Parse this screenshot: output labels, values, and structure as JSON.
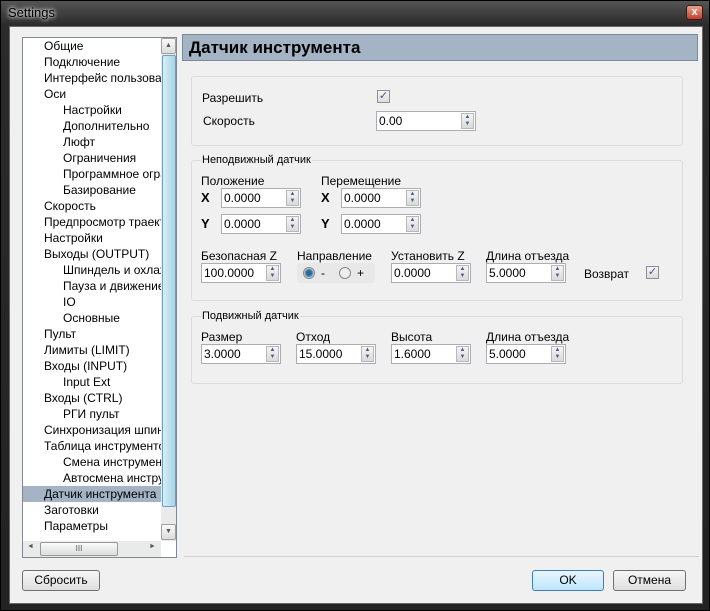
{
  "window": {
    "title": "Settings",
    "close_label": "x"
  },
  "tree": {
    "items": [
      {
        "label": "Общие",
        "level": 1
      },
      {
        "label": "Подключение",
        "level": 1
      },
      {
        "label": "Интерфейс пользовате",
        "level": 1
      },
      {
        "label": "Оси",
        "level": 1
      },
      {
        "label": "Настройки",
        "level": 2
      },
      {
        "label": "Дополнительно",
        "level": 2
      },
      {
        "label": "Люфт",
        "level": 2
      },
      {
        "label": "Ограничения",
        "level": 2
      },
      {
        "label": "Программное огра",
        "level": 2
      },
      {
        "label": "Базирование",
        "level": 2
      },
      {
        "label": "Скорость",
        "level": 1
      },
      {
        "label": "Предпросмотр траекто",
        "level": 1
      },
      {
        "label": "Настройки",
        "level": 1
      },
      {
        "label": "Выходы (OUTPUT)",
        "level": 1
      },
      {
        "label": "Шпиндель и охлажд",
        "level": 2
      },
      {
        "label": "Пауза и движение",
        "level": 2
      },
      {
        "label": "IO",
        "level": 2
      },
      {
        "label": "Основные",
        "level": 2
      },
      {
        "label": "Пульт",
        "level": 1
      },
      {
        "label": "Лимиты (LIMIT)",
        "level": 1
      },
      {
        "label": "Входы (INPUT)",
        "level": 1
      },
      {
        "label": "Input Ext",
        "level": 2
      },
      {
        "label": "Входы (CTRL)",
        "level": 1
      },
      {
        "label": "РГИ пульт",
        "level": 2
      },
      {
        "label": "Синхронизация шпинде",
        "level": 1
      },
      {
        "label": "Таблица инструментов",
        "level": 1
      },
      {
        "label": "Смена инструмента",
        "level": 2
      },
      {
        "label": "Автосмена инструм",
        "level": 2
      },
      {
        "label": "Датчик инструмента",
        "level": 1,
        "selected": true
      },
      {
        "label": "Заготовки",
        "level": 1
      },
      {
        "label": "Параметры",
        "level": 1
      }
    ],
    "scroll_up": "▲",
    "scroll_down": "▼",
    "scroll_left": "◄",
    "scroll_right": "►",
    "grip": "III"
  },
  "header": {
    "title": "Датчик инструмента"
  },
  "general": {
    "enable_label": "Разрешить",
    "enable_checked": true,
    "speed_label": "Скорость",
    "speed_value": "0.00"
  },
  "fixed": {
    "title": "Неподвижный датчик",
    "position_label": "Положение",
    "move_label": "Перемещение",
    "x_label": "X",
    "y_label": "Y",
    "pos_x": "0.0000",
    "pos_y": "0.0000",
    "move_x": "0.0000",
    "move_y": "0.0000",
    "safe_z_label": "Безопасная Z",
    "safe_z": "100.0000",
    "direction_label": "Направление",
    "dir_minus": "-",
    "dir_plus": "+",
    "direction": "-",
    "set_z_label": "Установить Z",
    "set_z": "0.0000",
    "retract_label": "Длина отъезда",
    "retract": "5.0000",
    "return_label": "Возврат",
    "return_checked": true
  },
  "movable": {
    "title": "Подвижный датчик",
    "size_label": "Размер",
    "size": "3.0000",
    "offset_label": "Отход",
    "offset": "15.0000",
    "height_label": "Высота",
    "height": "1.6000",
    "retract_label": "Длина отъезда",
    "retract": "5.0000"
  },
  "buttons": {
    "reset": "Сбросить",
    "ok": "OK",
    "cancel": "Отмена"
  },
  "check_glyph": "✓",
  "spin_glyph": "▲▼"
}
